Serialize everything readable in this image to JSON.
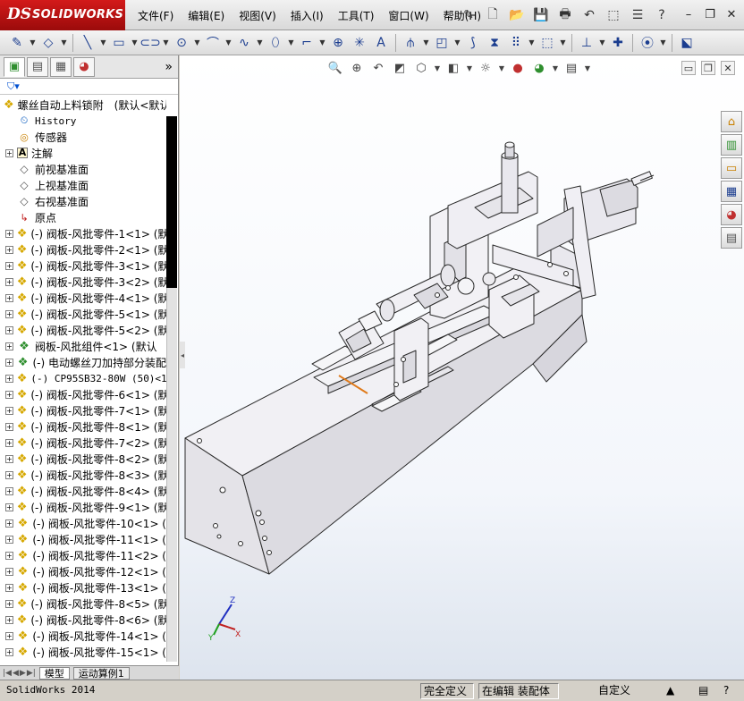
{
  "app": {
    "logo_prefix": "DS",
    "logo_name": "SOLIDWORKS"
  },
  "menu": [
    "文件(F)",
    "编辑(E)",
    "视图(V)",
    "插入(I)",
    "工具(T)",
    "窗口(W)",
    "帮助(H)"
  ],
  "feature_tree": {
    "root": "螺丝自动上料锁附　(默认<默认_",
    "items": [
      {
        "label": "History",
        "icon": "history-icon",
        "expandable": false,
        "mono": true
      },
      {
        "label": "传感器",
        "icon": "sensor-icon",
        "expandable": false
      },
      {
        "label": "注解",
        "icon": "annotation-icon",
        "expandable": true
      },
      {
        "label": "前视基准面",
        "icon": "plane-icon",
        "expandable": false
      },
      {
        "label": "上视基准面",
        "icon": "plane-icon",
        "expandable": false
      },
      {
        "label": "右视基准面",
        "icon": "plane-icon",
        "expandable": false
      },
      {
        "label": "原点",
        "icon": "origin-icon",
        "expandable": false
      },
      {
        "label": "(-) 阀板-风批零件-1<1> (默",
        "icon": "part-icon",
        "expandable": true
      },
      {
        "label": "(-) 阀板-风批零件-2<1> (默",
        "icon": "part-icon",
        "expandable": true
      },
      {
        "label": "(-) 阀板-风批零件-3<1> (默",
        "icon": "part-icon",
        "expandable": true
      },
      {
        "label": "(-) 阀板-风批零件-3<2> (默",
        "icon": "part-icon",
        "expandable": true
      },
      {
        "label": "(-) 阀板-风批零件-4<1> (默",
        "icon": "part-icon",
        "expandable": true
      },
      {
        "label": "(-) 阀板-风批零件-5<1> (默",
        "icon": "part-icon",
        "expandable": true
      },
      {
        "label": "(-) 阀板-风批零件-5<2> (默",
        "icon": "part-icon",
        "expandable": true
      },
      {
        "label": "阀板-风批组件<1> (默认",
        "icon": "assembly-icon",
        "expandable": true
      },
      {
        "label": "(-) 电动螺丝刀加持部分装配",
        "icon": "assembly-icon",
        "expandable": true
      },
      {
        "label": "(-) CP95SB32-80W (50)<1>",
        "icon": "part-icon",
        "expandable": true,
        "mono": true
      },
      {
        "label": "(-) 阀板-风批零件-6<1> (默",
        "icon": "part-icon",
        "expandable": true
      },
      {
        "label": "(-) 阀板-风批零件-7<1> (默",
        "icon": "part-icon",
        "expandable": true
      },
      {
        "label": "(-) 阀板-风批零件-8<1> (默",
        "icon": "part-icon",
        "expandable": true
      },
      {
        "label": "(-) 阀板-风批零件-7<2> (默",
        "icon": "part-icon",
        "expandable": true
      },
      {
        "label": "(-) 阀板-风批零件-8<2> (默",
        "icon": "part-icon",
        "expandable": true
      },
      {
        "label": "(-) 阀板-风批零件-8<3> (默",
        "icon": "part-icon",
        "expandable": true
      },
      {
        "label": "(-) 阀板-风批零件-8<4> (默",
        "icon": "part-icon",
        "expandable": true
      },
      {
        "label": "(-) 阀板-风批零件-9<1> (默",
        "icon": "part-icon",
        "expandable": true
      },
      {
        "label": "(-) 阀板-风批零件-10<1> (",
        "icon": "part-icon",
        "expandable": true
      },
      {
        "label": "(-) 阀板-风批零件-11<1> (",
        "icon": "part-icon",
        "expandable": true
      },
      {
        "label": "(-) 阀板-风批零件-11<2> (",
        "icon": "part-icon",
        "expandable": true
      },
      {
        "label": "(-) 阀板-风批零件-12<1> (",
        "icon": "part-icon",
        "expandable": true
      },
      {
        "label": "(-) 阀板-风批零件-13<1> (",
        "icon": "part-icon",
        "expandable": true
      },
      {
        "label": "(-) 阀板-风批零件-8<5> (默",
        "icon": "part-icon",
        "expandable": true
      },
      {
        "label": "(-) 阀板-风批零件-8<6> (默",
        "icon": "part-icon",
        "expandable": true
      },
      {
        "label": "(-) 阀板-风批零件-14<1> (",
        "icon": "part-icon",
        "expandable": true
      },
      {
        "label": "(-) 阀板-风批零件-15<1> (",
        "icon": "part-icon",
        "expandable": true
      }
    ]
  },
  "bottom_tabs": [
    "模型",
    "运动算例1"
  ],
  "triad": {
    "x": "X",
    "y": "Y",
    "z": "Z"
  },
  "status": {
    "app_name": "SolidWorks 2014",
    "definition": "完全定义",
    "editing": "在编辑 装配体",
    "custom": "自定义"
  },
  "colors": {
    "logo_red": "#c01414",
    "model_fill": "#ecebef",
    "model_stroke": "#2a2a2a",
    "accent_orange": "#e07a1a"
  }
}
